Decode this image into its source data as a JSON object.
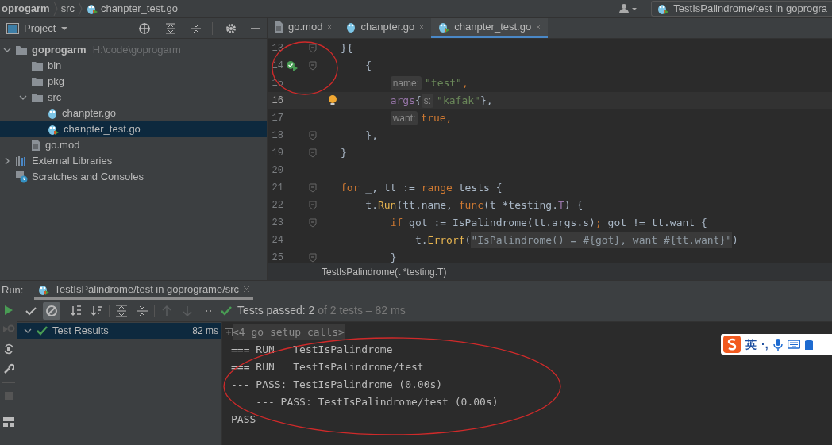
{
  "navbar": {
    "breadcrumbs": [
      "oprogarm",
      "src",
      "chanpter_test.go"
    ],
    "run_config": "TestIsPalindrome/test in goprogra"
  },
  "project": {
    "title": "Project",
    "tree": [
      {
        "label": "goprogarm",
        "path": "H:\\code\\goprogarm",
        "kind": "folder",
        "expanded": true,
        "selected": false,
        "children": [
          {
            "label": "bin",
            "kind": "folder",
            "selected": false
          },
          {
            "label": "pkg",
            "kind": "folder",
            "selected": false
          },
          {
            "label": "src",
            "kind": "folder",
            "expanded": true,
            "selected": false,
            "children": [
              {
                "label": "chanpter.go",
                "kind": "go",
                "selected": false
              },
              {
                "label": "chanpter_test.go",
                "kind": "gotest",
                "selected": true
              }
            ]
          },
          {
            "label": "go.mod",
            "kind": "file",
            "selected": false
          }
        ]
      },
      {
        "label": "External Libraries",
        "kind": "libs",
        "expanded": false,
        "selected": false
      },
      {
        "label": "Scratches and Consoles",
        "kind": "scratch",
        "selected": false
      }
    ]
  },
  "editor": {
    "tabs": [
      {
        "label": "go.mod",
        "kind": "file",
        "selected": false
      },
      {
        "label": "chanpter.go",
        "kind": "go",
        "selected": false
      },
      {
        "label": "chanpter_test.go",
        "kind": "gotest",
        "selected": true
      }
    ],
    "lines": [
      {
        "number": "13",
        "fold": true,
        "current": false,
        "tokens": [
          {
            "text": "}{",
            "kind": "plain"
          }
        ]
      },
      {
        "number": "14",
        "fold": true,
        "run": true,
        "current": false,
        "tokens": [
          {
            "text": "    {",
            "kind": "plain"
          }
        ]
      },
      {
        "number": "15",
        "current": false,
        "tokens": [
          {
            "text": "        name:",
            "kind": "hint"
          },
          {
            "text": "\"test\"",
            "kind": "str"
          },
          {
            "text": ",",
            "kind": "kw"
          }
        ]
      },
      {
        "number": "16",
        "current": true,
        "bulb": true,
        "tokens": [
          {
            "text": "        args",
            "kind": "field"
          },
          {
            "text": "{",
            "kind": "plain"
          },
          {
            "text": "s:",
            "kind": "hint"
          },
          {
            "text": "\"kafak\"",
            "kind": "str"
          },
          {
            "text": "},",
            "kind": "plain"
          }
        ]
      },
      {
        "number": "17",
        "current": false,
        "tokens": [
          {
            "text": "        want:",
            "kind": "hint"
          },
          {
            "text": "true,",
            "kind": "kw"
          }
        ]
      },
      {
        "number": "18",
        "fold": true,
        "current": false,
        "tokens": [
          {
            "text": "    },",
            "kind": "plain"
          }
        ]
      },
      {
        "number": "19",
        "fold": true,
        "current": false,
        "tokens": [
          {
            "text": "}",
            "kind": "plain"
          }
        ]
      },
      {
        "number": "20",
        "current": false
      },
      {
        "number": "21",
        "fold": true,
        "current": false,
        "tokens": [
          {
            "text": "for",
            "kind": "kw"
          },
          {
            "text": " _, tt := ",
            "kind": "plain"
          },
          {
            "text": "range",
            "kind": "kw"
          },
          {
            "text": " tests {",
            "kind": "plain"
          }
        ]
      },
      {
        "number": "22",
        "fold": true,
        "current": false,
        "tokens": [
          {
            "text": "    t.",
            "kind": "plain"
          },
          {
            "text": "Run",
            "kind": "call"
          },
          {
            "text": "(tt.name, ",
            "kind": "plain"
          },
          {
            "text": "func",
            "kind": "kw"
          },
          {
            "text": "(t *testing.",
            "kind": "plain"
          },
          {
            "text": "T",
            "kind": "field"
          },
          {
            "text": ") {",
            "kind": "plain"
          }
        ]
      },
      {
        "number": "23",
        "fold": true,
        "current": false,
        "tokens": [
          {
            "text": "        if",
            "kind": "kw"
          },
          {
            "text": " got := IsPalindrome(tt.args.s)",
            "kind": "plain"
          },
          {
            "text": ";",
            "kind": "kw"
          },
          {
            "text": " got != tt.want {",
            "kind": "plain"
          }
        ]
      },
      {
        "number": "24",
        "current": false,
        "tokens": [
          {
            "text": "            t.",
            "kind": "plain"
          },
          {
            "text": "Errorf",
            "kind": "call"
          },
          {
            "text": "(",
            "kind": "plain"
          },
          {
            "text": "\"IsPalindrome() = #{got}, want #{tt.want}\"",
            "kind": "fmt"
          },
          {
            "text": ")",
            "kind": "plain"
          }
        ]
      },
      {
        "number": "25",
        "fold": true,
        "current": false,
        "tokens": [
          {
            "text": "        }",
            "kind": "plain"
          }
        ]
      }
    ],
    "breadcrumb": "TestIsPalindrome(t *testing.T)"
  },
  "run": {
    "label": "Run:",
    "tab": "TestIsPalindrome/test in goprograme/src",
    "status": {
      "passed": "Tests passed:",
      "count": "2",
      "rest": "of 2 tests – 82 ms"
    },
    "results": [
      {
        "label": "Test Results",
        "time": "82 ms",
        "selected": true
      }
    ],
    "console": [
      {
        "text": "<4 go setup calls>",
        "kind": "folded"
      },
      {
        "text": "=== RUN   TestIsPalindrome",
        "kind": "out"
      },
      {
        "text": "=== RUN   TestIsPalindrome/test",
        "kind": "out"
      },
      {
        "text": "--- PASS: TestIsPalindrome (0.00s)",
        "kind": "out"
      },
      {
        "text": "    --- PASS: TestIsPalindrome/test (0.00s)",
        "kind": "out"
      },
      {
        "text": "PASS",
        "kind": "out"
      }
    ]
  },
  "ime": {
    "lang": "英",
    "punct": "·,"
  }
}
